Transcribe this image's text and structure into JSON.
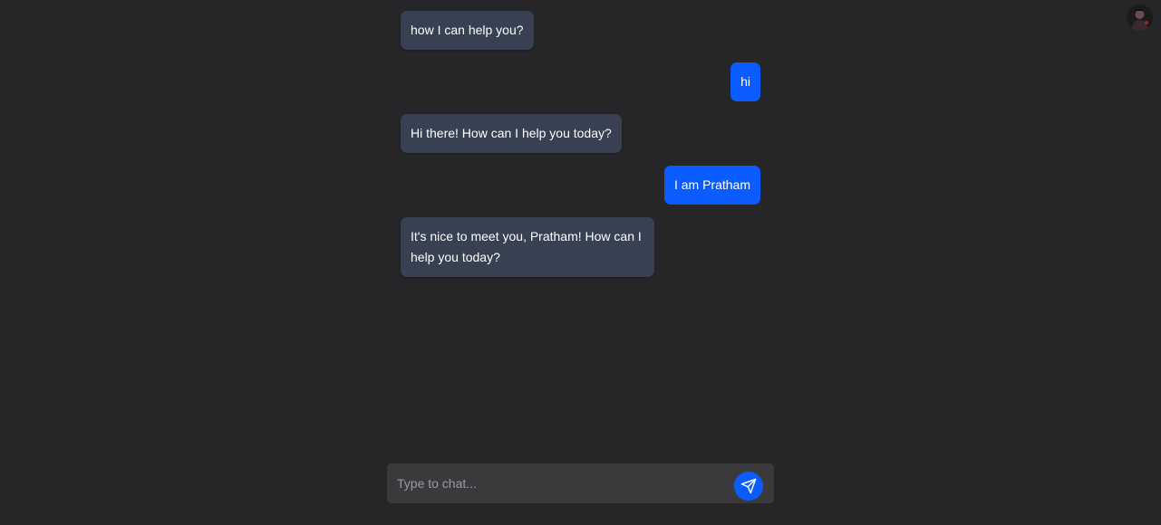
{
  "messages": [
    {
      "role": "bot",
      "text": "how I can help you?"
    },
    {
      "role": "user",
      "text": "hi"
    },
    {
      "role": "bot",
      "text": "Hi there! How can I help you today?"
    },
    {
      "role": "user",
      "text": "I am Pratham"
    },
    {
      "role": "bot",
      "text": "It's nice to meet you, Pratham! How can I help you today?"
    }
  ],
  "composer": {
    "placeholder": "Type to chat...",
    "value": ""
  },
  "icons": {
    "send": "send-icon",
    "avatar": "avatar-icon"
  },
  "colors": {
    "background": "#262628",
    "bot_bubble": "#374151",
    "user_bubble": "#0b5cff",
    "composer": "#3a3a3d",
    "accent": "#0b5cff"
  }
}
